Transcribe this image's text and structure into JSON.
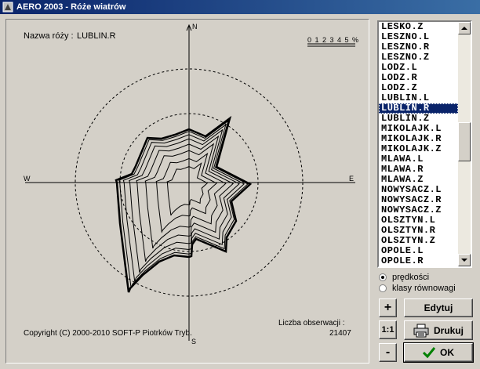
{
  "window": {
    "title": "AERO 2003 - Róże wiatrów"
  },
  "rose": {
    "name_label": "Nazwa róży :",
    "name_value": "LUBLIN.R",
    "scale_ticks": [
      "0",
      "1",
      "2",
      "3",
      "4",
      "5",
      "%"
    ],
    "directions": {
      "n": "N",
      "e": "E",
      "s": "S",
      "w": "W"
    },
    "copyright": "Copyright (C) 2000-2010 SOFT-P Piotrków Tryb.",
    "obs_label": "Liczba obserwacji :",
    "obs_value": "21407"
  },
  "list": {
    "items": [
      "LESKO.Z",
      "LESZNO.L",
      "LESZNO.R",
      "LESZNO.Z",
      "LODZ.L",
      "LODZ.R",
      "LODZ.Z",
      "LUBLIN.L",
      "LUBLIN.R",
      "LUBLIN.Z",
      "MIKOLAJK.L",
      "MIKOLAJK.R",
      "MIKOLAJK.Z",
      "MLAWA.L",
      "MLAWA.R",
      "MLAWA.Z",
      "NOWYSACZ.L",
      "NOWYSACZ.R",
      "NOWYSACZ.Z",
      "OLSZTYN.L",
      "OLSZTYN.R",
      "OLSZTYN.Z",
      "OPOLE.L",
      "OPOLE.R"
    ],
    "selected": "LUBLIN.R"
  },
  "options": {
    "speeds": "prędkości",
    "stability": "klasy równowagi",
    "selected": "speeds"
  },
  "buttons": {
    "plus": "+",
    "ratio": "1:1",
    "minus": "-",
    "edit": "Edytuj",
    "print": "Drukuj",
    "ok": "OK"
  },
  "icons": {
    "app": "app-icon",
    "print": "printer-icon",
    "ok": "checkmark-icon",
    "scroll_up": "arrow-up-icon",
    "scroll_down": "arrow-down-icon"
  }
}
